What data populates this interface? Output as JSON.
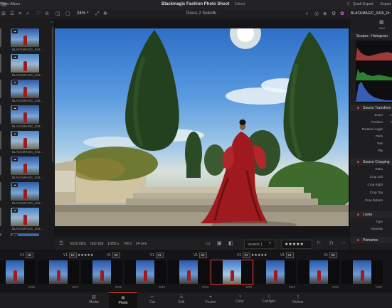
{
  "topbar": {
    "album": "Photo Album",
    "title": "Blackmagic Fashion Photo Shoot",
    "status": "Edited",
    "quick_export": "Quick Export",
    "export": "Export"
  },
  "toolbar": {
    "zoom": "24%",
    "dress_label": "Dress 2 Selects",
    "current_file": "BLACKMAGIC_0426_Dr"
  },
  "left_panel": {
    "items": [
      {
        "label": "BLACKMAGIC_042..."
      },
      {
        "label": "BLACKMAGIC_042..."
      },
      {
        "label": "BLACKMAGIC_042..."
      },
      {
        "label": "BLACKMAGIC_042..."
      },
      {
        "label": "BLACKMAGIC_042..."
      },
      {
        "label": "BLACKMAGIC_042..."
      },
      {
        "label": "BLACKMAGIC_042..."
      },
      {
        "label": "BLACKMAGIC_042..."
      },
      {
        "label": "BLACKMAGIC_042..."
      }
    ]
  },
  "viewer_bar": {
    "camera": "EOS 5DS",
    "iso": "ISO 100",
    "shutter": "1/250 s",
    "aperture": "F8.0",
    "focal": "24 mm",
    "version": "Version 1",
    "stars": "★★★★★"
  },
  "right_panel": {
    "tool_label": "Grid",
    "scopes_title": "Scopes - Histogram",
    "source_transform": "Source Transform",
    "props_transform": [
      "Zoom",
      "Position",
      "Rotation Angle",
      "Pitch",
      "Yaw",
      "Flip"
    ],
    "source_cropping": "Source Cropping",
    "props_crop": [
      "Ratio",
      "Crop Left",
      "Crop Right",
      "Crop Top",
      "Crop Bottom"
    ],
    "looks": "Looks",
    "props_looks": [
      "Type",
      "Intensity"
    ],
    "primaries": "Primaries",
    "x_mark": "X"
  },
  "filmstrip": {
    "clips": [
      {
        "v": "V1",
        "num": "18",
        "stars": "",
        "name": "CR2"
      },
      {
        "v": "V1",
        "num": "19",
        "stars": "★★★★★",
        "name": "CR2"
      },
      {
        "v": "V1",
        "num": "20",
        "stars": "",
        "name": "CR2"
      },
      {
        "v": "V1",
        "num": "21",
        "stars": "",
        "name": "CR2"
      },
      {
        "v": "V1",
        "num": "22",
        "stars": "",
        "name": "CR2"
      },
      {
        "v": "V1",
        "num": "23",
        "stars": "★★★★★",
        "name": "CR2"
      },
      {
        "v": "V1",
        "num": "24",
        "stars": "",
        "name": "CR2"
      },
      {
        "v": "V1",
        "num": "25",
        "stars": "",
        "name": "CR2"
      },
      {
        "v": "",
        "num": "",
        "stars": "",
        "name": "CR2"
      }
    ]
  },
  "bottom_nav": {
    "items": [
      "Media",
      "Photo",
      "Cut",
      "Edit",
      "Fusion",
      "Color",
      "Fairlight",
      "Deliver"
    ],
    "active": "Photo"
  },
  "colors": {
    "accent": "#e03a3a",
    "sky": "#3f83d3",
    "dress": "#9e1a1e"
  }
}
